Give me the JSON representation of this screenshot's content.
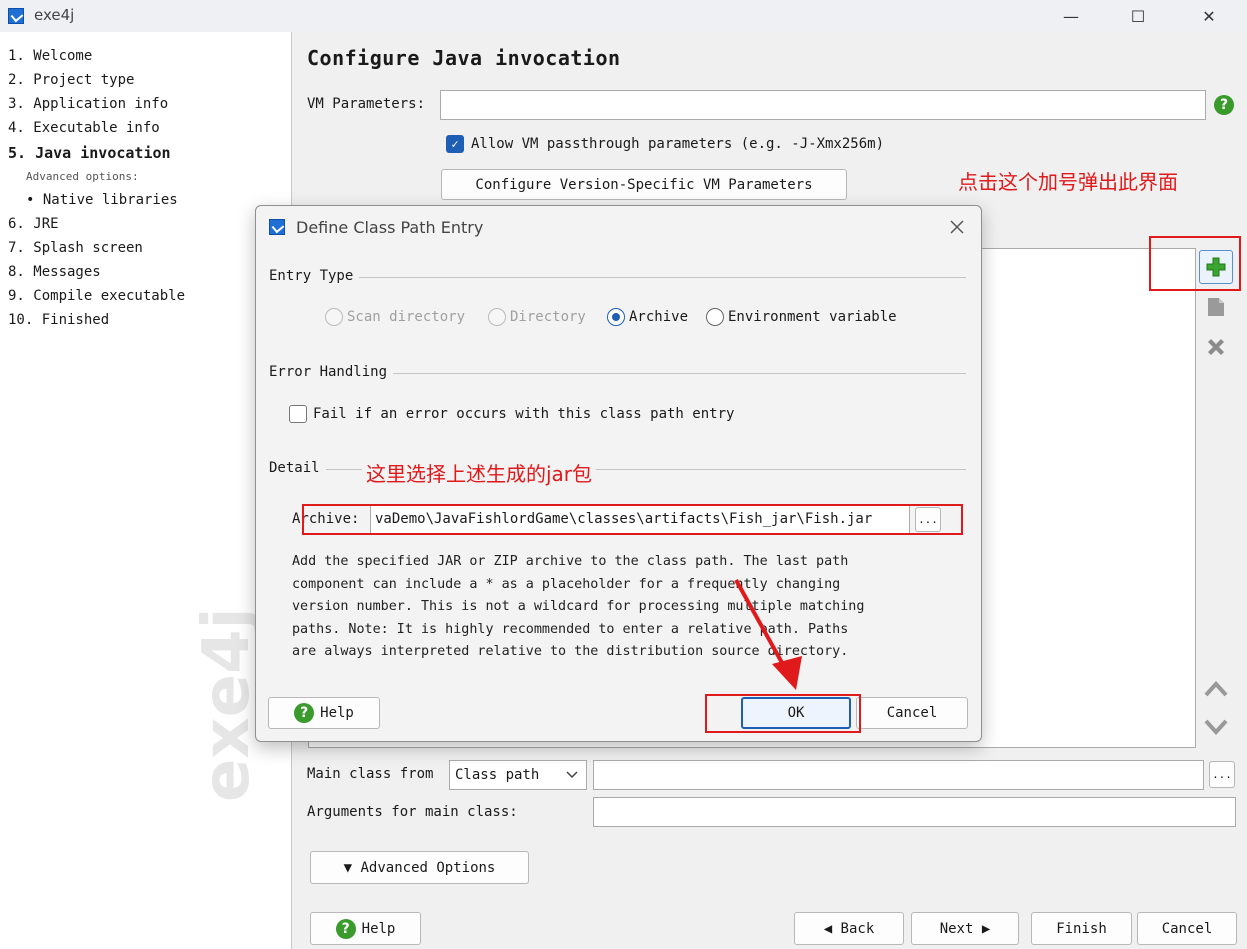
{
  "window": {
    "title": "exe4j",
    "minimize": "—",
    "maximize": "☐",
    "close": "✕"
  },
  "nav": {
    "items": [
      {
        "label": "1. Welcome"
      },
      {
        "label": "2. Project type"
      },
      {
        "label": "3. Application info"
      },
      {
        "label": "4. Executable info"
      },
      {
        "label": "5. Java invocation"
      },
      {
        "label": "Advanced options:"
      },
      {
        "label": "• Native libraries"
      },
      {
        "label": "6. JRE"
      },
      {
        "label": "7. Splash screen"
      },
      {
        "label": "8. Messages"
      },
      {
        "label": "9. Compile executable"
      },
      {
        "label": "10. Finished"
      }
    ],
    "watermark": "exe4j"
  },
  "main": {
    "heading": "Configure Java invocation",
    "vm_params_label": "VM Parameters:",
    "vm_params_value": "",
    "allow_passthrough_label": "Allow VM passthrough parameters (e.g. -J-Xmx256m)",
    "allow_passthrough_checked": true,
    "config_version_button": "Configure Version-Specific VM Parameters",
    "main_class_from_label": "Main class from",
    "main_class_from_value": "Class path",
    "main_class_value": "",
    "browse_label": "...",
    "args_label": "Arguments for main class:",
    "args_value": "",
    "advanced_options_button": "▼ Advanced Options",
    "help_button": "Help",
    "back_button": "◀ Back",
    "next_button": "Next ▶",
    "finish_button": "Finish",
    "cancel_button": "Cancel"
  },
  "annotations": {
    "plus_note": "点击这个加号弹出此界面",
    "jar_note": "这里选择上述生成的jar包"
  },
  "dialog": {
    "title": "Define Class Path Entry",
    "entry_type_title": "Entry Type",
    "entry_types": [
      {
        "label": "Scan directory",
        "state": "disabled"
      },
      {
        "label": "Directory",
        "state": "disabled"
      },
      {
        "label": "Archive",
        "state": "selected"
      },
      {
        "label": "Environment variable",
        "state": "enabled"
      }
    ],
    "error_handling_title": "Error Handling",
    "fail_label": "Fail if an error occurs with this class path entry",
    "fail_checked": false,
    "detail_title": "Detail",
    "archive_label": "Archive:",
    "archive_value": "vaDemo\\JavaFishlordGame\\classes\\artifacts\\Fish_jar\\Fish.jar",
    "browse_label": "...",
    "description_lines": [
      "Add the specified JAR or ZIP archive to the class path. The last path",
      "component can include a * as a placeholder for a frequently changing",
      "version number. This is not a wildcard for processing multiple matching",
      "paths. Note: It is highly recommended to enter a relative path. Paths",
      "are always interpreted relative to the distribution source directory."
    ],
    "help_button": "Help",
    "ok_button": "OK",
    "cancel_button": "Cancel"
  },
  "colors": {
    "accent": "#1e5eb5",
    "annotation": "#e0191b",
    "help_green": "#3a9a2c"
  }
}
